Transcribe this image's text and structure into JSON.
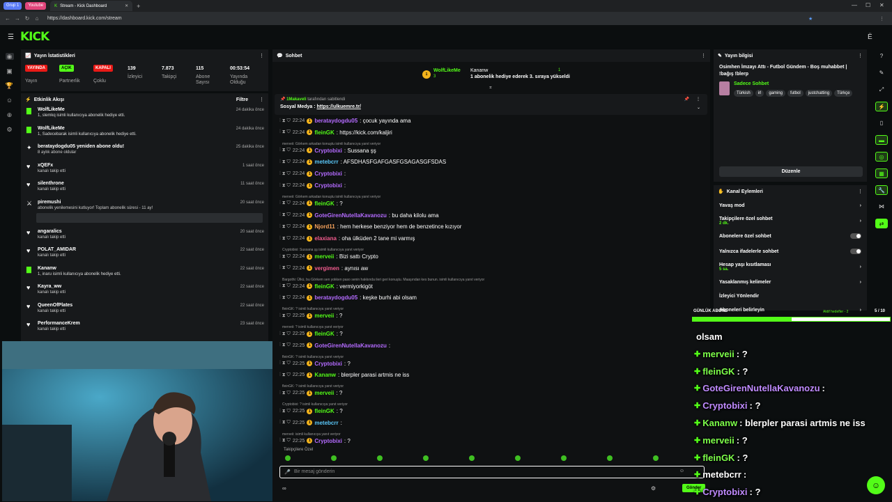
{
  "browser": {
    "tab_groups": [
      "Grup 1",
      "Youtube"
    ],
    "tab_title": "Stream - Kick Dashboard",
    "url": "https://dashboard.kick.com/stream"
  },
  "logo": "KICK",
  "stats": {
    "title": "Yayın İstatistikleri",
    "items": [
      {
        "badge": "YAYINDA",
        "badge_color": "#e91916",
        "label": "Yayın"
      },
      {
        "badge": "AÇIK",
        "badge_color": "#53fc18",
        "label": "Partnerlik"
      },
      {
        "badge": "KAPALI",
        "badge_color": "#e91916",
        "label": "Çoklu"
      },
      {
        "value": "139",
        "label": "İzleyici"
      },
      {
        "value": "7.873",
        "label": "Takipçi"
      },
      {
        "value": "115",
        "label": "Abone Sayısı"
      },
      {
        "value": "00:53:54",
        "label": "Yayında Olduğu"
      }
    ]
  },
  "activity": {
    "title": "Etkinlik Akışı",
    "filter": "Filtre",
    "items": [
      {
        "icon": "gift",
        "name": "WolfLikeMe",
        "sub": "1, slemkq isimli kullanıcıya abonelik hediye etti.",
        "time": "24 dakika önce"
      },
      {
        "icon": "gift",
        "name": "WolfLikeMe",
        "sub": "1, Sadecebarak isimli kullanıcıya abonelik hediye etti.",
        "time": "24 dakika önce"
      },
      {
        "icon": "star",
        "name": "berataydogdu05 yeniden abone oldu!",
        "sub": "8 aylık abone oldular",
        "time": "25 dakika önce"
      },
      {
        "icon": "heart",
        "name": "xQEFx",
        "sub": "kanalı takip etti",
        "time": "1 saat önce"
      },
      {
        "icon": "heart",
        "name": "silenthrone",
        "sub": "kanalı takip etti",
        "time": "11 saat önce"
      },
      {
        "icon": "resub",
        "name": "piremushi",
        "sub": "abonelik yenilemesini kutluyor! Toplam abonelik süresi - 11 ay!",
        "time": "20 saat önce"
      },
      {
        "icon": "heart",
        "name": "angaralics",
        "sub": "kanalı takip etti",
        "time": "20 saat önce"
      },
      {
        "icon": "heart",
        "name": "POLAT_AMIDAR",
        "sub": "kanalı takip etti",
        "time": "22 saat önce"
      },
      {
        "icon": "gift",
        "name": "Kananw",
        "sub": "1, inaru isimli kullanıcıya abonelik hediye etti.",
        "time": "22 saat önce"
      },
      {
        "icon": "heart",
        "name": "Kayra_ww",
        "sub": "kanalı takip etti",
        "time": "22 saat önce"
      },
      {
        "icon": "heart",
        "name": "QueenOfPlates",
        "sub": "kanalı takip etti",
        "time": "22 saat önce"
      },
      {
        "icon": "heart",
        "name": "PerformanceKrem",
        "sub": "kanalı takip etti",
        "time": "23 saat önce"
      }
    ]
  },
  "chat": {
    "title": "Sohbet",
    "gift": {
      "user": "WolfLikeMe",
      "count": "3",
      "user2": "Kananw",
      "count2": "1",
      "text": "1 abonelik hediye ederek 3. sıraya yükseldi"
    },
    "pinned": {
      "by": "1Makaveli",
      "by_text": "tarafından sabitlendi",
      "text": "Sosyal Medya :",
      "link": "https://ulkuemre.tr/"
    },
    "messages": [
      {
        "time": "22:24",
        "user": "berataydogdu05",
        "color": "#b46bff",
        "text": ": çocuk yayında ama"
      },
      {
        "time": "22:24",
        "user": "fleinGK",
        "color": "#53fc18",
        "text": ": https://kick.com/kaljiri"
      },
      {
        "reply": "merveii: Görkem arkadan konuştu isimli kullanıcıya yanıt veriyor"
      },
      {
        "time": "22:24",
        "user": "Cryptobixi",
        "color": "#b46bff",
        "text": ": Sussana şş"
      },
      {
        "time": "22:24",
        "user": "metebcrr",
        "color": "#5ac8fa",
        "text": ": AFSDHASFGAFGASFGSAGASGFSDAS"
      },
      {
        "time": "22:24",
        "user": "Cryptobixi",
        "color": "#b46bff",
        "text": ":"
      },
      {
        "time": "22:24",
        "user": "Cryptobixi",
        "color": "#b46bff",
        "text": ":"
      },
      {
        "reply": "merveii: Görkem arkadan konuştu isimli kullanıcıya yanıt veriyor"
      },
      {
        "time": "22:24",
        "user": "fleinGK",
        "color": "#53fc18",
        "text": ": ?"
      },
      {
        "time": "22:24",
        "user": "GoteGirenNutellaKavanozu",
        "color": "#b46bff",
        "text": ": bu daha kilolu ama"
      },
      {
        "time": "22:24",
        "user": "Njord11",
        "color": "#f7a35c",
        "text": ": hem herkese benziyor hem de benzetince kızıyor"
      },
      {
        "time": "22:24",
        "user": "elaxiana",
        "color": "#f45c8f",
        "text": ": oha ülküden 2 tane mi varmış"
      },
      {
        "reply": "Cryptobixi: Sussana şş isimli kullanıcıya yanıt veriyor"
      },
      {
        "time": "22:24",
        "user": "merveii",
        "color": "#53fc18",
        "text": ": Bizi sattı Crypto"
      },
      {
        "time": "22:24",
        "user": "vergimen",
        "color": "#f45c8f",
        "text": ": aynısı aw"
      },
      {
        "reply": "Bargothi: Ülkü, bu Görkem sen yokken paso senin hakkında ileri geri konuştu. Maaşından kes bunun. isimli kullanıcıya yanıt veriyor"
      },
      {
        "time": "22:24",
        "user": "fleinGK",
        "color": "#53fc18",
        "text": ": vermiyorkigöt"
      },
      {
        "time": "22:24",
        "user": "berataydogdu05",
        "color": "#b46bff",
        "text": ": keşke burhi abi olsam"
      },
      {
        "reply": "fleinGK: ? isimli kullanıcıya yanıt veriyor"
      },
      {
        "time": "22:25",
        "user": "merveii",
        "color": "#53fc18",
        "text": ": ?"
      },
      {
        "reply": "merveii: ? isimli kullanıcıya yanıt veriyor"
      },
      {
        "time": "22:25",
        "user": "fleinGK",
        "color": "#53fc18",
        "text": ": ?"
      },
      {
        "time": "22:25",
        "user": "GoteGirenNutellaKavanozu",
        "color": "#b46bff",
        "text": ":"
      },
      {
        "reply": "fleinGK: ? isimli kullanıcıya yanıt veriyor"
      },
      {
        "time": "22:25",
        "user": "Cryptobixi",
        "color": "#b46bff",
        "text": ": ?"
      },
      {
        "time": "22:25",
        "user": "Kananw",
        "color": "#53fc18",
        "text": ": blerpler parasi artmis ne iss"
      },
      {
        "reply": "fleinGK: ? isimli kullanıcıya yanıt veriyor"
      },
      {
        "time": "22:25",
        "user": "merveii",
        "color": "#53fc18",
        "text": ": ?"
      },
      {
        "reply": "Cryptobixi: ? isimli kullanıcıya yanıt veriyor"
      },
      {
        "time": "22:25",
        "user": "fleinGK",
        "color": "#53fc18",
        "text": ": ?"
      },
      {
        "time": "22:25",
        "user": "metebcrr",
        "color": "#5ac8fa",
        "text": ":"
      },
      {
        "reply": "merveii: isimli kullanıcıya yanıt veriyor"
      },
      {
        "time": "22:25",
        "user": "Cryptobixi",
        "color": "#b46bff",
        "text": ": ?"
      }
    ],
    "followers_only": "Takipçilere Özel",
    "input_placeholder": "Bir mesaj gönderin",
    "send": "Gönder"
  },
  "stream_info": {
    "title": "Yayın bilgisi",
    "stream_title": "Osimhen İmzayı Attı - Futbol Gündem - Boş muhabbet | !bağış !blerp",
    "category": "Sadece Sohbet",
    "tags": [
      "Türkish",
      "irl",
      "gaming",
      "futbol",
      "justchatting",
      "Türkçe"
    ],
    "edit": "Düzenle"
  },
  "channel_actions": {
    "title": "Kanal Eylemleri",
    "items": [
      {
        "label": "Yavaş mod",
        "control": "arrow"
      },
      {
        "label": "Takipçilere özel sohbet",
        "sub": "2 dk.",
        "control": "arrow"
      },
      {
        "label": "Abonelere özel sohbet",
        "control": "toggle"
      },
      {
        "label": "Yalnızca ifadelerle sohbet",
        "control": "toggle"
      },
      {
        "label": "Hesap yaşı kısıtlaması",
        "sub": "5 sa.",
        "control": "arrow"
      },
      {
        "label": "Yasaklanmış kelimeler",
        "control": "arrow"
      },
      {
        "label": "İzleyici Yönlendir",
        "control": "none"
      },
      {
        "label": "Aboneleri belirleyin",
        "control": "arrow"
      }
    ]
  },
  "overlay": {
    "goal_label": "GÜNLÜK ABONE",
    "goal_sub": "Aktif hedefler - 2",
    "goal_value": "5 / 10",
    "goal_progress": 0.5,
    "lines": [
      {
        "user": "",
        "text": "olsam",
        "color": "#ffffff"
      },
      {
        "user": "merveii",
        "text": " : ?",
        "color": "#7dff4a"
      },
      {
        "user": "fleinGK",
        "text": " : ?",
        "color": "#7dff4a"
      },
      {
        "user": "GoteGirenNutellaKavanozu",
        "text": " :",
        "color": "#c08bff"
      },
      {
        "user": "Cryptobixi",
        "text": " : ?",
        "color": "#c08bff"
      },
      {
        "user": "Kananw",
        "text": " : blerpler parasi artmis ne iss",
        "color": "#7dff4a"
      },
      {
        "user": "merveii",
        "text": " : ?",
        "color": "#7dff4a"
      },
      {
        "user": "fleinGK",
        "text": " : ?",
        "color": "#7dff4a"
      },
      {
        "user": "metebcrr",
        "text": " :",
        "color": "#ffffff"
      },
      {
        "user": "Cryptobixi",
        "text": " : ?",
        "color": "#c08bff"
      }
    ]
  },
  "colors": {
    "accent": "#53fc18",
    "live": "#e91916"
  }
}
